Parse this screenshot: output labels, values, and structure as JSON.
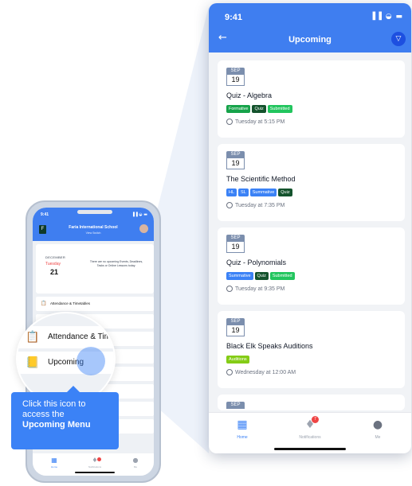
{
  "big_phone": {
    "time": "9:41",
    "status_icons": "▐▐ ◒ ▬",
    "back_icon": "←",
    "title": "Upcoming",
    "filter_icon": "▽",
    "events": [
      {
        "month": "SEP",
        "day": "19",
        "title": "Quiz - Algebra",
        "tags": [
          "Formative",
          "Quiz",
          "Submitted"
        ],
        "time": "Tuesday at 5:15 PM"
      },
      {
        "month": "SEP",
        "day": "19",
        "title": "The Scientific Method",
        "tags": [
          "HL",
          "SL",
          "Summative",
          "Quiz"
        ],
        "time": "Tuesday at 7:35 PM"
      },
      {
        "month": "SEP",
        "day": "19",
        "title": "Quiz - Polynomials",
        "tags": [
          "Summative",
          "Quiz",
          "Submitted"
        ],
        "time": "Tuesday at 9:35 PM"
      },
      {
        "month": "SEP",
        "day": "19",
        "title": "Black Elk Speaks Auditions",
        "tags": [
          "Auditions"
        ],
        "time": "Wednesday at 12:00 AM"
      },
      {
        "month": "SEP"
      }
    ],
    "tabbar": {
      "home": "Home",
      "notifications": "Notifications",
      "notifications_count": "7",
      "me": "Me"
    }
  },
  "small_phone": {
    "time": "9:41",
    "status_icons": "▐▐ ◒ ▬",
    "logo_letter": "F",
    "school_name": "Faria International School",
    "switch_label": "View Switch",
    "calendar": {
      "month": "DECEMBER",
      "weekday": "Tuesday",
      "day": "21",
      "empty_message": "There are no upcoming Events, Deadlines, Tasks or Online Lessons today."
    },
    "rows": [
      "Attendance & Timetables"
    ],
    "partial_row": "ATT",
    "tabbar": {
      "home": "Home",
      "notifications": "Notifications",
      "me": "Me"
    }
  },
  "magnifier": {
    "row1": "Attendance & Tim",
    "row2": "Upcoming"
  },
  "callout": {
    "line1": "Click this icon to",
    "line2": "access the",
    "line3": "Upcoming Menu"
  },
  "colors": {
    "accent": "#3f7ef0",
    "callout": "#3b82f6",
    "badge": "#ef4444"
  }
}
